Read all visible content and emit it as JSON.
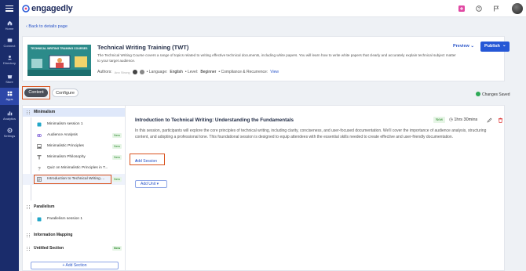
{
  "nav": {
    "items": [
      {
        "label": "Home",
        "icon": "home-icon"
      },
      {
        "label": "Connect",
        "icon": "connect-icon"
      },
      {
        "label": "Directory",
        "icon": "directory-icon"
      },
      {
        "label": "Store",
        "icon": "store-icon"
      },
      {
        "label": "Apps",
        "icon": "apps-icon",
        "active": true
      },
      {
        "label": "Analytics",
        "icon": "analytics-icon"
      },
      {
        "label": "Settings",
        "icon": "settings-icon"
      }
    ]
  },
  "topbar": {
    "logo": "engagedly"
  },
  "back_link": "Back to details page",
  "course": {
    "thumb_title": "TECHNICAL WRITING TRAINING COURSES",
    "title": "Technical Writing Training (TWT)",
    "description": "The Technical Writing Course covers a range of topics related to writing effective technical documents, including white papers. You will learn how to write white papers that clearly and accurately explain technical subject matter to your target audience.",
    "authors_label": "Authors:",
    "author_name": "Ann Strong",
    "language_label": "• Language:",
    "language": "English",
    "level_label": "• Level:",
    "level": "Beginner",
    "compliance_label": "• Compliance & Recurrence:",
    "compliance_link": "View",
    "preview_label": "Preview",
    "publish_label": "Publish"
  },
  "tabs": {
    "content": "Content",
    "configure": "Configure"
  },
  "saved_status": "Changes Saved",
  "outline": {
    "sections": [
      {
        "title": "Minimalism",
        "items": [
          {
            "label": "Minimalism session 1",
            "icon": "session-icon",
            "new": false
          },
          {
            "label": "Audience Analysis",
            "icon": "link-icon",
            "new": true
          },
          {
            "label": "Minimalistic Principles",
            "icon": "image-icon",
            "new": true
          },
          {
            "label": "Minimalism Philosophy",
            "icon": "text-icon",
            "new": true
          },
          {
            "label": "Quiz on Minimalistic Principles in T...",
            "icon": "quiz-icon",
            "new": false
          },
          {
            "label": "Introduction to Technical Writing ...",
            "icon": "presentation-icon",
            "new": true,
            "active": true
          }
        ]
      },
      {
        "title": "Parallelism",
        "items": [
          {
            "label": "Parallelism session 1",
            "icon": "session-icon",
            "new": false
          }
        ]
      },
      {
        "title": "Information Mapping",
        "items": []
      },
      {
        "title": "Untitled Section",
        "items": [],
        "new": true
      }
    ],
    "new_label": "New",
    "add_section": "Add Section"
  },
  "lesson": {
    "title": "Introduction to Technical Writing: Understanding the Fundamentals",
    "badge": "New",
    "duration": "1hrs 30mins",
    "description": "In this session, participants will explore the core principles of technical writing, including clarity, conciseness, and user-focused documentation. We'll cover the importance of audience analysis, structuring content, and adopting a professional tone. This foundational session is designed to equip attendees with the essential skills needed to create effective and user-friendly documentation.",
    "add_session": "Add Session",
    "add_unit": "Add Unit"
  }
}
